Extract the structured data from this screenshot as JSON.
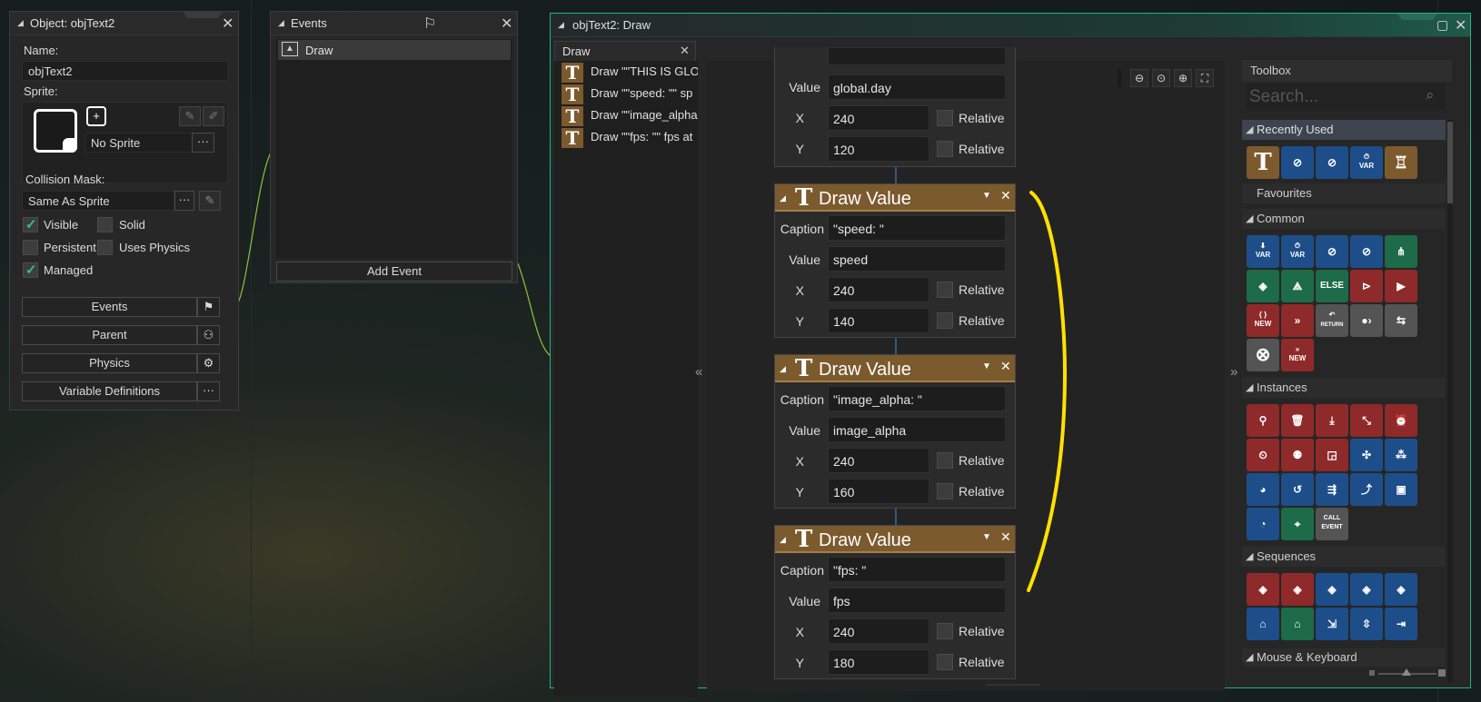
{
  "object_panel": {
    "title": "Object: objText2",
    "name_label": "Name:",
    "name_value": "objText2",
    "sprite_label": "Sprite:",
    "sprite_value": "No Sprite",
    "more": "···",
    "collision_label": "Collision Mask:",
    "collision_value": "Same As Sprite",
    "checkboxes": {
      "visible": "Visible",
      "solid": "Solid",
      "persistent": "Persistent",
      "uses_physics": "Uses Physics",
      "managed": "Managed"
    },
    "checked": {
      "visible": true,
      "solid": false,
      "persistent": false,
      "uses_physics": false,
      "managed": true
    },
    "buttons": {
      "events": "Events",
      "parent": "Parent",
      "physics": "Physics",
      "variable_definitions": "Variable Definitions"
    }
  },
  "events_panel": {
    "title": "Events",
    "items": [
      "Draw"
    ],
    "add_event": "Add Event"
  },
  "editor": {
    "title": "objText2: Draw",
    "tab": "Draw",
    "event_list": [
      "Draw \"\"THIS IS GLO",
      "Draw \"\"speed: \"\" sp",
      "Draw \"\"image_alpha",
      "Draw \"\"fps: \"\" fps at"
    ],
    "collapse_left": "«",
    "collapse_right": "»",
    "top_block": {
      "value_label": "Value",
      "value": "global.day",
      "x_label": "X",
      "x": "240",
      "y_label": "Y",
      "y": "120",
      "relative": "Relative"
    },
    "blocks": [
      {
        "name": "Draw Value",
        "caption_label": "Caption",
        "caption": "\"speed: \"",
        "value_label": "Value",
        "value": "speed",
        "x_label": "X",
        "x": "240",
        "y_label": "Y",
        "y": "140",
        "relative": "Relative"
      },
      {
        "name": "Draw Value",
        "caption_label": "Caption",
        "caption": "\"image_alpha: \"",
        "value_label": "Value",
        "value": "image_alpha",
        "x_label": "X",
        "x": "240",
        "y_label": "Y",
        "y": "160",
        "relative": "Relative"
      },
      {
        "name": "Draw Value",
        "caption_label": "Caption",
        "caption": "\"fps: \"",
        "value_label": "Value",
        "value": "fps",
        "x_label": "X",
        "x": "240",
        "y_label": "Y",
        "y": "180",
        "relative": "Relative"
      }
    ],
    "annotation_color": "#ffe000"
  },
  "toolbox": {
    "title": "Toolbox",
    "search_placeholder": "Search...",
    "sections": {
      "recently_used": "Recently Used",
      "favourites": "Favourites",
      "common": "Common",
      "instances": "Instances",
      "sequences": "Sequences",
      "mouse_keyboard": "Mouse & Keyboard"
    },
    "icon_labels": {
      "var": "VAR",
      "else": "ELSE",
      "new": "NEW",
      "return": "RETURN",
      "call_event": "CALL EVENT"
    }
  },
  "colors": {
    "accent": "#1fb58a",
    "action_header": "#7b5a2e",
    "tile_blue": "#1e4e8a",
    "tile_red": "#8f2a2a",
    "tile_green": "#1d6b48"
  }
}
